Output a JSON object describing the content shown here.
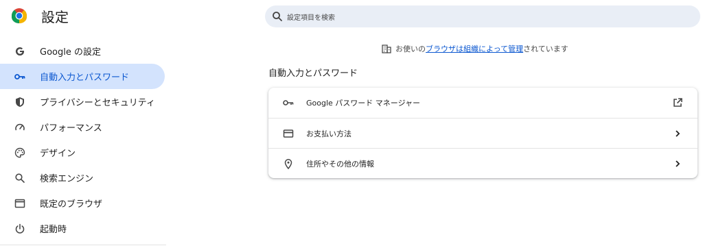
{
  "app": {
    "title": "設定",
    "logo_icon": "chrome-logo-icon"
  },
  "search": {
    "placeholder": "設定項目を検索",
    "icon": "search-icon"
  },
  "sidebar": {
    "items": [
      {
        "label": "Google の設定",
        "icon": "google-g-icon",
        "active": false
      },
      {
        "label": "自動入力とパスワード",
        "icon": "key-icon",
        "active": true
      },
      {
        "label": "プライバシーとセキュリティ",
        "icon": "shield-icon",
        "active": false
      },
      {
        "label": "パフォーマンス",
        "icon": "speedometer-icon",
        "active": false
      },
      {
        "label": "デザイン",
        "icon": "palette-icon",
        "active": false
      },
      {
        "label": "検索エンジン",
        "icon": "search-icon",
        "active": false
      },
      {
        "label": "既定のブラウザ",
        "icon": "browser-window-icon",
        "active": false
      },
      {
        "label": "起動時",
        "icon": "power-icon",
        "active": false
      }
    ]
  },
  "managed_notice": {
    "prefix": "お使いの",
    "link": "ブラウザは組織によって管理",
    "suffix": "されています",
    "icon": "building-icon"
  },
  "section": {
    "title": "自動入力とパスワード",
    "rows": [
      {
        "label": "Google パスワード マネージャー",
        "icon": "key-icon",
        "action_icon": "open-in-new-icon"
      },
      {
        "label": "お支払い方法",
        "icon": "credit-card-icon",
        "action_icon": "chevron-right-icon"
      },
      {
        "label": "住所やその他の情報",
        "icon": "location-pin-icon",
        "action_icon": "chevron-right-icon"
      }
    ]
  },
  "colors": {
    "accent": "#0b57d0",
    "active_bg": "#d3e3fd",
    "search_bg": "#e9eef6"
  }
}
